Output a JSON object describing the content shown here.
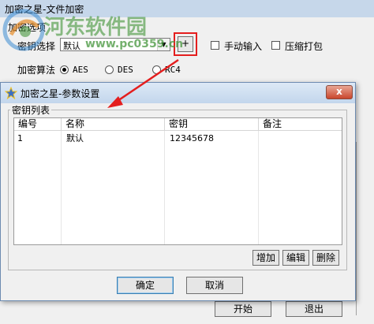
{
  "main_window": {
    "title": "加密之星-文件加密",
    "group_label": "加密选项",
    "key_select_label": "密钥选择",
    "key_select_value": "默认",
    "add_button": "+",
    "manual_input_label": "手动输入",
    "compress_label": "压缩打包",
    "algo_label": "加密算法",
    "algorithms": [
      "AES",
      "DES",
      "RC4"
    ],
    "selected_algorithm": "AES",
    "start_button": "开始",
    "exit_button": "退出"
  },
  "watermark": {
    "text": "河东软件园",
    "url": "www.pc0359.cn"
  },
  "dialog": {
    "title": "加密之星-参数设置",
    "close_label": "x",
    "group_label": "密钥列表",
    "columns": [
      "编号",
      "名称",
      "密钥",
      "备注"
    ],
    "rows": [
      {
        "id": "1",
        "name": "默认",
        "key": "12345678",
        "note": ""
      }
    ],
    "add_button": "增加",
    "edit_button": "编辑",
    "delete_button": "删除",
    "ok_button": "确定",
    "cancel_button": "取消"
  },
  "colors": {
    "highlight": "#e41e1e",
    "watermark_green": "#46963c",
    "title_bar": "#c3d6ec"
  }
}
